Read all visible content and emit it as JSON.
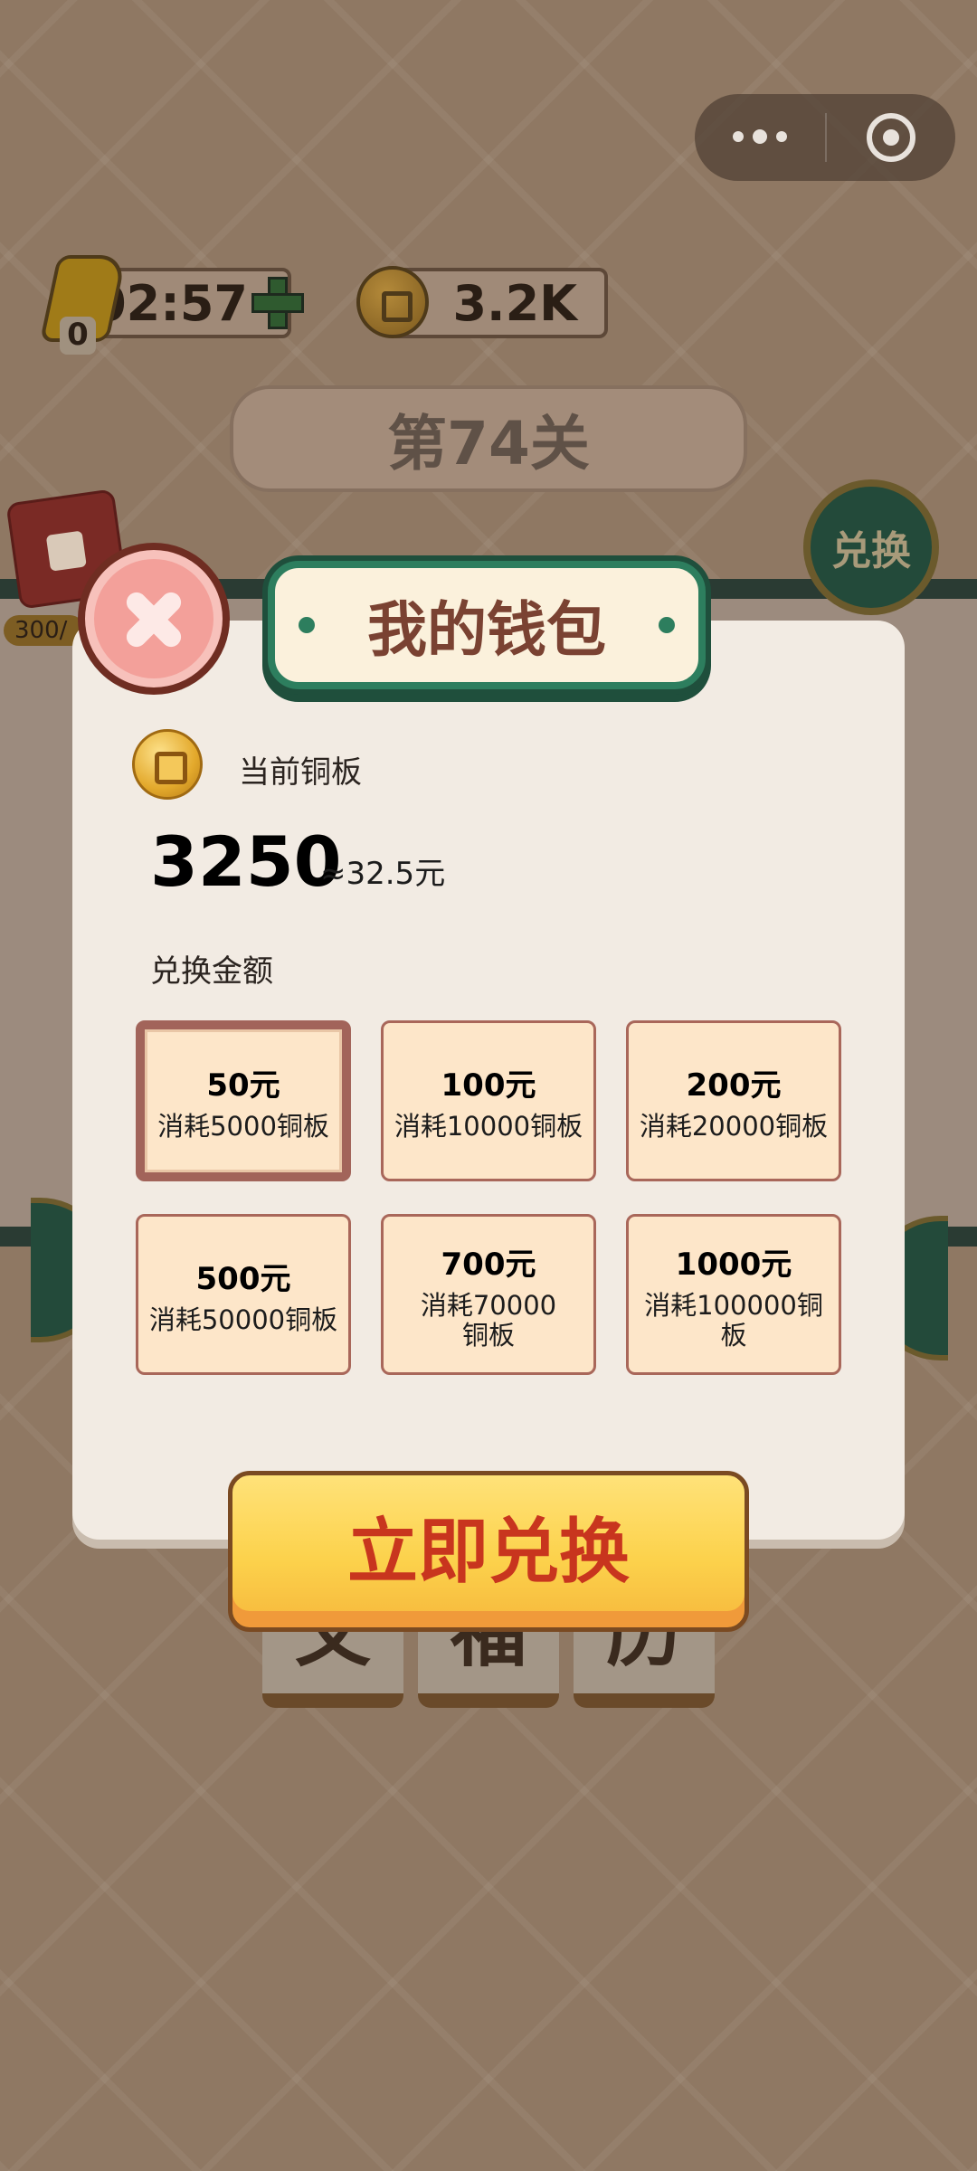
{
  "hud": {
    "timer": "02:57",
    "energy_count": "0",
    "coins": "3.2K",
    "level": "第74关",
    "exchange_button": "兑换",
    "redbag_progress": "300/"
  },
  "capsule": {
    "more_icon": "more-dots-icon",
    "close_icon": "target-circle-icon"
  },
  "tiles": [
    "文",
    "福",
    "历"
  ],
  "wallet": {
    "title": "我的钱包",
    "current_label": "当前铜板",
    "balance": "3250",
    "approx_value": "≈32.5元",
    "amount_label": "兑换金额",
    "options": [
      {
        "amount": "50元",
        "cost": "消耗5000铜板",
        "selected": true
      },
      {
        "amount": "100元",
        "cost": "消耗10000铜板",
        "selected": false
      },
      {
        "amount": "200元",
        "cost": "消耗20000铜板",
        "selected": false
      },
      {
        "amount": "500元",
        "cost": "消耗50000铜板",
        "selected": false
      },
      {
        "amount": "700元",
        "cost": "消耗70000铜板",
        "selected": false
      },
      {
        "amount": "1000元",
        "cost": "消耗100000铜板",
        "selected": false
      }
    ],
    "redeem_button": "立即兑换"
  },
  "colors": {
    "modal_bg": "#f2ebe3",
    "accent_green": "#2d7e5e",
    "title_text": "#7a4232",
    "option_bg": "#fde6c9",
    "button_yellow": "#fcd24c",
    "button_text": "#c8351e",
    "close_pink": "#f3a09a"
  }
}
